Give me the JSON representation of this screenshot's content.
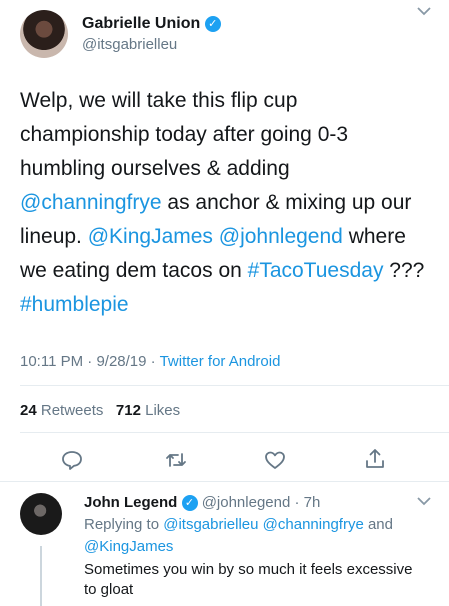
{
  "tweet": {
    "author_name": "Gabrielle Union",
    "author_handle": "@itsgabrielleu",
    "text_parts": [
      {
        "t": "Welp, we will take this flip cup championship today after going 0-3 humbling ourselves & adding ",
        "link": false
      },
      {
        "t": "@channingfrye",
        "link": true
      },
      {
        "t": " as anchor & mixing up our lineup. ",
        "link": false
      },
      {
        "t": "@KingJames",
        "link": true
      },
      {
        "t": " ",
        "link": false
      },
      {
        "t": "@johnlegend",
        "link": true
      },
      {
        "t": " where we eating dem tacos on ",
        "link": false
      },
      {
        "t": "#TacoTuesday",
        "link": true
      },
      {
        "t": " ??? ",
        "link": false
      },
      {
        "t": "#humblepie",
        "link": true
      }
    ],
    "time": "10:11 PM",
    "date": "9/28/19",
    "source": "Twitter for Android",
    "retweets_count": "24",
    "retweets_label": "Retweets",
    "likes_count": "712",
    "likes_label": "Likes"
  },
  "actions": [
    {
      "name": "reply-icon"
    },
    {
      "name": "retweet-icon"
    },
    {
      "name": "like-icon"
    },
    {
      "name": "share-icon"
    }
  ],
  "reply": {
    "author_name": "John Legend",
    "author_handle": "@johnlegend",
    "time": "7h",
    "replying_prefix": "Replying to",
    "replying_to": [
      "@itsgabrielleu",
      "@channingfrye",
      "@KingJames"
    ],
    "replying_and": "and",
    "text": "Sometimes you win by so much it feels excessive to gloat"
  },
  "colors": {
    "link": "#1b95e0",
    "verified": "#1da1f2",
    "muted": "#657786"
  }
}
